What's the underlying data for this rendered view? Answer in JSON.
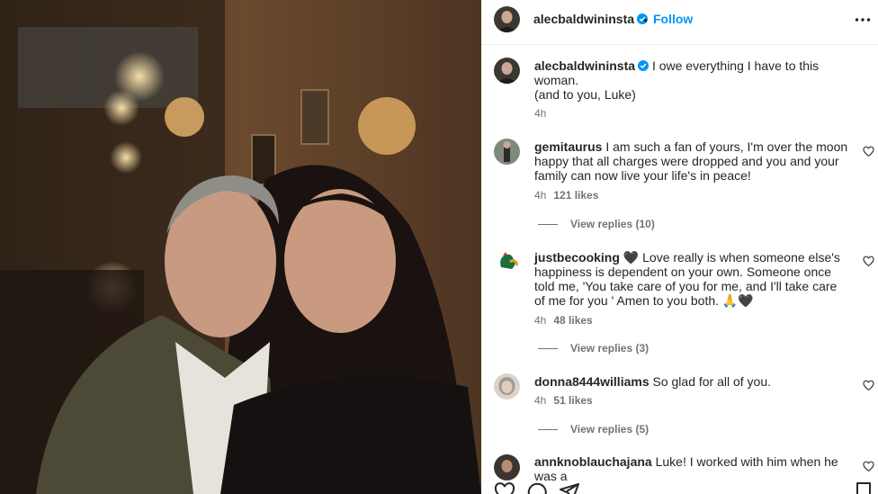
{
  "post": {
    "author": "alecbaldwininsta",
    "follow_label": "Follow",
    "separator": "•",
    "caption_author": "alecbaldwininsta",
    "caption_text": "I owe everything I have to this woman.",
    "caption_line2": "(and to you, Luke)",
    "caption_time": "4h"
  },
  "comments": [
    {
      "user": "gemitaurus",
      "text": "I am such a fan of yours, I'm over the moon happy that all charges were dropped and you and your family can now live your life's in peace!",
      "time": "4h",
      "likes": "121 likes",
      "replies": "View replies (10)"
    },
    {
      "user": "justbecooking",
      "text": "🖤 Love really is when someone else's happiness is dependent on your own. Someone once told me, 'You take care of you for me, and I'll take care of me for you ' Amen to you both. 🙏🖤",
      "time": "4h",
      "likes": "48 likes",
      "replies": "View replies (3)"
    },
    {
      "user": "donna8444williams",
      "text": "So glad for all of you.",
      "time": "4h",
      "likes": "51 likes",
      "replies": "View replies (5)"
    },
    {
      "user": "annknoblauchajana",
      "text": "Luke! I worked with him when he was a"
    }
  ],
  "icons": [
    "verified-icon",
    "more-icon",
    "heart-icon",
    "comment-icon",
    "share-icon",
    "bookmark-icon"
  ],
  "colors": {
    "accent": "#0095f6",
    "verified": "#0095f6",
    "muted": "#737373"
  }
}
